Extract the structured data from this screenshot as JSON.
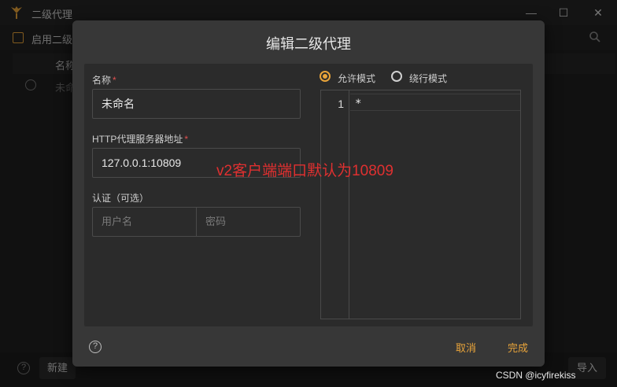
{
  "window": {
    "title": "二级代理",
    "minimize": "—",
    "maximize": "☐",
    "close": "✕"
  },
  "toolbar": {
    "enable_label": "启用二级"
  },
  "table": {
    "col_name": "名称",
    "row_name": "未命"
  },
  "bottom": {
    "help": "?",
    "new_label": "新建",
    "import_label": "导入"
  },
  "dialog": {
    "title": "编辑二级代理",
    "name_label": "名称",
    "required_mark": "*",
    "name_value": "未命名",
    "server_label": "HTTP代理服务器地址",
    "server_value": "127.0.0.1:10809",
    "auth_label": "认证（可选）",
    "username_placeholder": "用户名",
    "password_placeholder": "密码",
    "mode_allow": "允许模式",
    "mode_bypass": "绕行模式",
    "selected_mode": "允许模式",
    "editor": {
      "line_number": "1",
      "line_text": "*"
    },
    "help": "?",
    "cancel_label": "取消",
    "done_label": "完成"
  },
  "annotation": "v2客户端端口默认为10809",
  "watermark": "CSDN @icyfirekiss",
  "colors": {
    "accent": "#e9a43a",
    "annotation": "#e03030",
    "required": "#e05050"
  }
}
